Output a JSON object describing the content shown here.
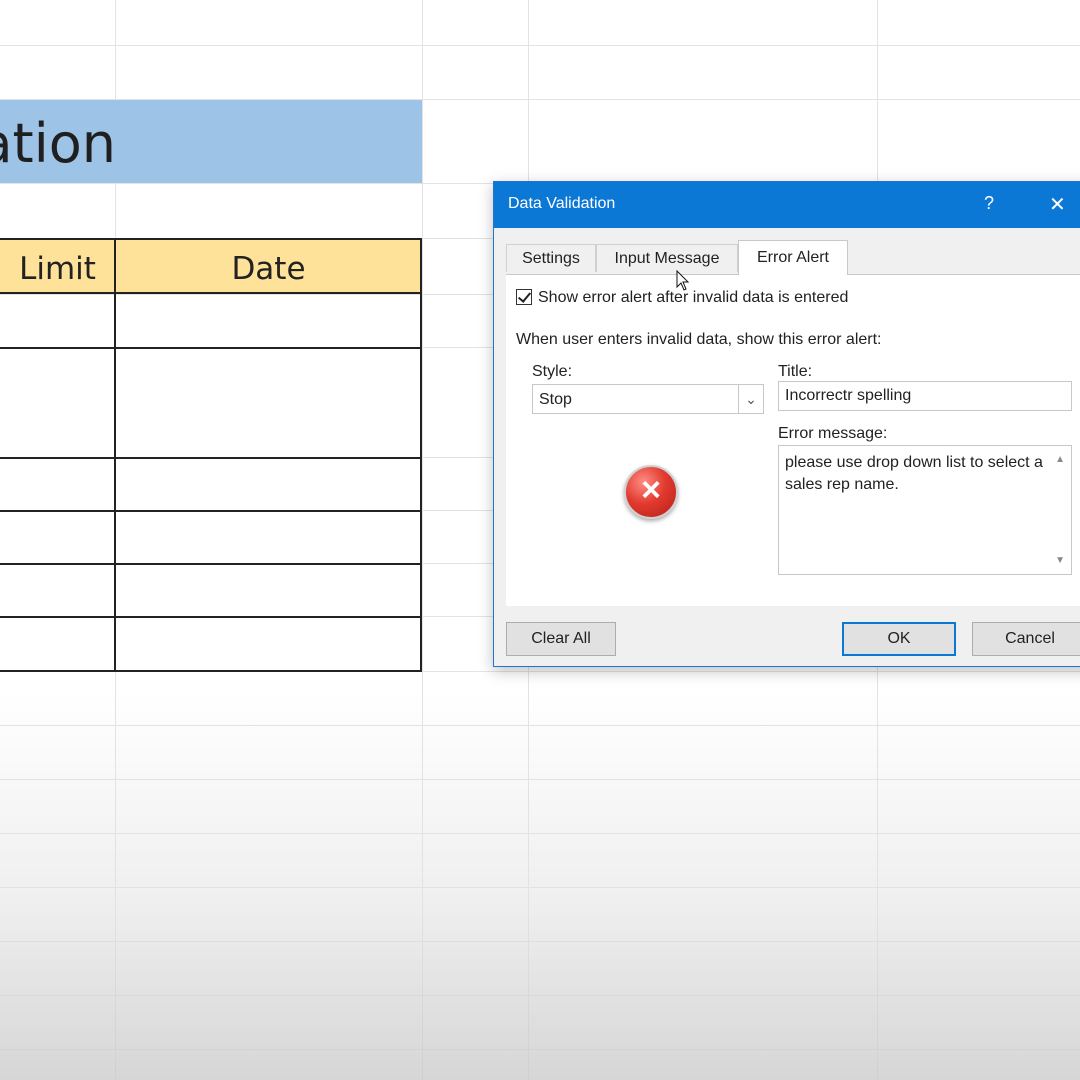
{
  "sheet": {
    "banner_text": "ation",
    "table_headers": [
      "Limit",
      "Date"
    ]
  },
  "dialog": {
    "title": "Data Validation",
    "help_glyph": "?",
    "close_glyph": "✕",
    "tabs": [
      {
        "label": "Settings",
        "active": false
      },
      {
        "label": "Input Message",
        "active": false
      },
      {
        "label": "Error Alert",
        "active": true
      }
    ],
    "show_error_alert_label": "Show error alert after invalid data is entered",
    "show_error_alert_checked": true,
    "section_label": "When user enters invalid data, show this error alert:",
    "style_label": "Style:",
    "style_value": "Stop",
    "title_label": "Title:",
    "title_value": "Incorrectr spelling",
    "error_message_label": "Error message:",
    "error_message_value": "please use drop down list to select a sales rep name.",
    "icon": "stop-error-icon",
    "buttons": {
      "clear_all": "Clear All",
      "ok": "OK",
      "cancel": "Cancel"
    }
  },
  "colors": {
    "title_bar": "#0c78d6",
    "banner": "#9dc3e6",
    "table_header": "#ffe29a",
    "stop_icon": "#e23b30"
  }
}
